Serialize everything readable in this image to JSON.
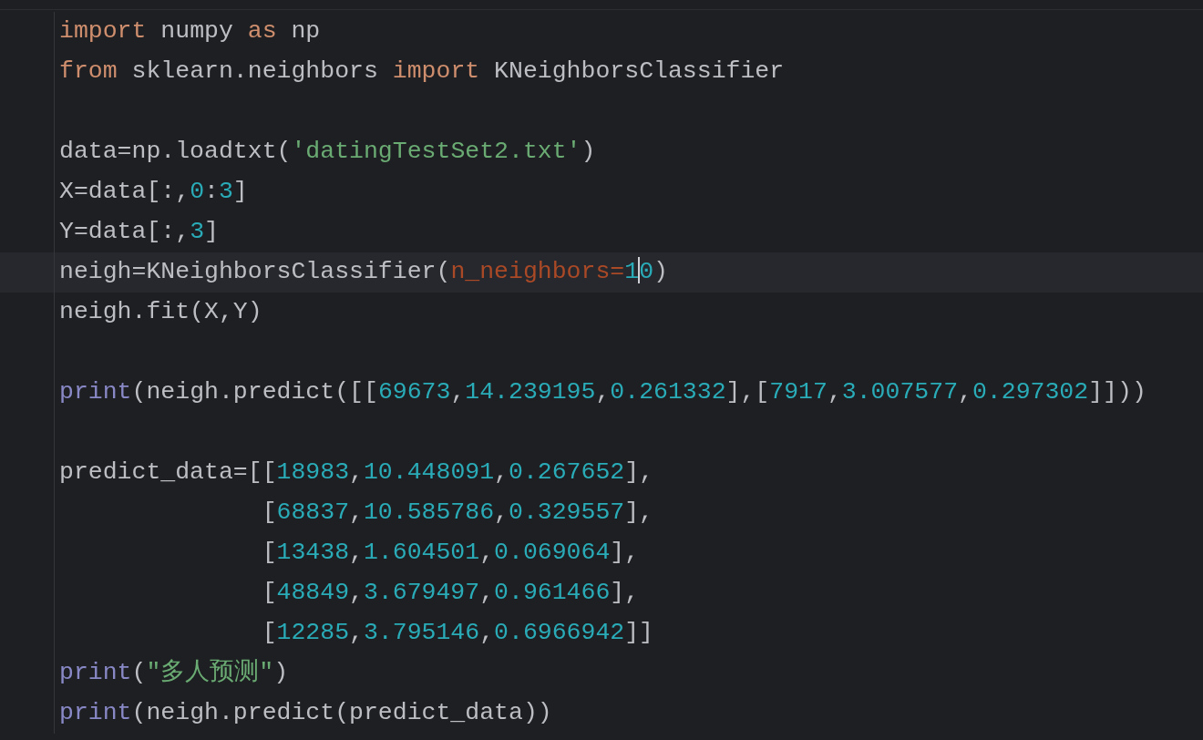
{
  "editor": {
    "lines": [
      {
        "current": false,
        "tokens": [
          {
            "kind": "keyword",
            "text": "import"
          },
          {
            "kind": "plain",
            "text": " numpy "
          },
          {
            "kind": "keyword",
            "text": "as"
          },
          {
            "kind": "plain",
            "text": " np"
          }
        ]
      },
      {
        "current": false,
        "tokens": [
          {
            "kind": "keyword",
            "text": "from"
          },
          {
            "kind": "plain",
            "text": " sklearn.neighbors "
          },
          {
            "kind": "keyword",
            "text": "import"
          },
          {
            "kind": "plain",
            "text": " KNeighborsClassifier"
          }
        ]
      },
      {
        "current": false
      },
      {
        "current": false,
        "tokens": [
          {
            "kind": "plain",
            "text": "data=np.loadtxt("
          },
          {
            "kind": "string",
            "text": "'datingTestSet2.txt'"
          },
          {
            "kind": "plain",
            "text": ")"
          }
        ]
      },
      {
        "current": false,
        "tokens": [
          {
            "kind": "plain",
            "text": "X=data[:,"
          },
          {
            "kind": "number",
            "text": "0"
          },
          {
            "kind": "plain",
            "text": ":"
          },
          {
            "kind": "number",
            "text": "3"
          },
          {
            "kind": "plain",
            "text": "]"
          }
        ]
      },
      {
        "current": false,
        "tokens": [
          {
            "kind": "plain",
            "text": "Y=data[:,"
          },
          {
            "kind": "number",
            "text": "3"
          },
          {
            "kind": "plain",
            "text": "]"
          }
        ]
      },
      {
        "current": true,
        "tokens": [
          {
            "kind": "plain",
            "text": "neigh=KNeighborsClassifier("
          },
          {
            "kind": "parameter",
            "text": "n_neighbors="
          },
          {
            "kind": "number",
            "text": "1"
          },
          {
            "kind": "caret"
          },
          {
            "kind": "number",
            "text": "0"
          },
          {
            "kind": "plain",
            "text": ")"
          }
        ]
      },
      {
        "current": false,
        "tokens": [
          {
            "kind": "plain",
            "text": "neigh.fit(X,Y)"
          }
        ]
      },
      {
        "current": false
      },
      {
        "current": false,
        "tokens": [
          {
            "kind": "builtin",
            "text": "print"
          },
          {
            "kind": "plain",
            "text": "(neigh.predict([["
          },
          {
            "kind": "number",
            "text": "69673"
          },
          {
            "kind": "plain",
            "text": ","
          },
          {
            "kind": "number",
            "text": "14.239195"
          },
          {
            "kind": "plain",
            "text": ","
          },
          {
            "kind": "number",
            "text": "0.261332"
          },
          {
            "kind": "plain",
            "text": "],["
          },
          {
            "kind": "number",
            "text": "7917"
          },
          {
            "kind": "plain",
            "text": ","
          },
          {
            "kind": "number",
            "text": "3.007577"
          },
          {
            "kind": "plain",
            "text": ","
          },
          {
            "kind": "number",
            "text": "0.297302"
          },
          {
            "kind": "plain",
            "text": "]]))"
          }
        ]
      },
      {
        "current": false
      },
      {
        "current": false,
        "tokens": [
          {
            "kind": "plain",
            "text": "predict_data=[["
          },
          {
            "kind": "number",
            "text": "18983"
          },
          {
            "kind": "plain",
            "text": ","
          },
          {
            "kind": "number",
            "text": "10.448091"
          },
          {
            "kind": "plain",
            "text": ","
          },
          {
            "kind": "number",
            "text": "0.267652"
          },
          {
            "kind": "plain",
            "text": "],"
          }
        ]
      },
      {
        "current": false,
        "tokens": [
          {
            "kind": "plain",
            "text": "              ["
          },
          {
            "kind": "number",
            "text": "68837"
          },
          {
            "kind": "plain",
            "text": ","
          },
          {
            "kind": "number",
            "text": "10.585786"
          },
          {
            "kind": "plain",
            "text": ","
          },
          {
            "kind": "number",
            "text": "0.329557"
          },
          {
            "kind": "plain",
            "text": "],"
          }
        ]
      },
      {
        "current": false,
        "tokens": [
          {
            "kind": "plain",
            "text": "              ["
          },
          {
            "kind": "number",
            "text": "13438"
          },
          {
            "kind": "plain",
            "text": ","
          },
          {
            "kind": "number",
            "text": "1.604501"
          },
          {
            "kind": "plain",
            "text": ","
          },
          {
            "kind": "number",
            "text": "0.069064"
          },
          {
            "kind": "plain",
            "text": "],"
          }
        ]
      },
      {
        "current": false,
        "tokens": [
          {
            "kind": "plain",
            "text": "              ["
          },
          {
            "kind": "number",
            "text": "48849"
          },
          {
            "kind": "plain",
            "text": ","
          },
          {
            "kind": "number",
            "text": "3.679497"
          },
          {
            "kind": "plain",
            "text": ","
          },
          {
            "kind": "number",
            "text": "0.961466"
          },
          {
            "kind": "plain",
            "text": "],"
          }
        ]
      },
      {
        "current": false,
        "tokens": [
          {
            "kind": "plain",
            "text": "              ["
          },
          {
            "kind": "number",
            "text": "12285"
          },
          {
            "kind": "plain",
            "text": ","
          },
          {
            "kind": "number",
            "text": "3.795146"
          },
          {
            "kind": "plain",
            "text": ","
          },
          {
            "kind": "number",
            "text": "0.6966942"
          },
          {
            "kind": "plain",
            "text": "]]"
          }
        ]
      },
      {
        "current": false,
        "tokens": [
          {
            "kind": "builtin",
            "text": "print"
          },
          {
            "kind": "plain",
            "text": "("
          },
          {
            "kind": "string",
            "text": "\"多人预测\""
          },
          {
            "kind": "plain",
            "text": ")"
          }
        ]
      },
      {
        "current": false,
        "tokens": [
          {
            "kind": "builtin",
            "text": "print"
          },
          {
            "kind": "plain",
            "text": "(neigh.predict(predict_data))"
          }
        ]
      }
    ]
  }
}
